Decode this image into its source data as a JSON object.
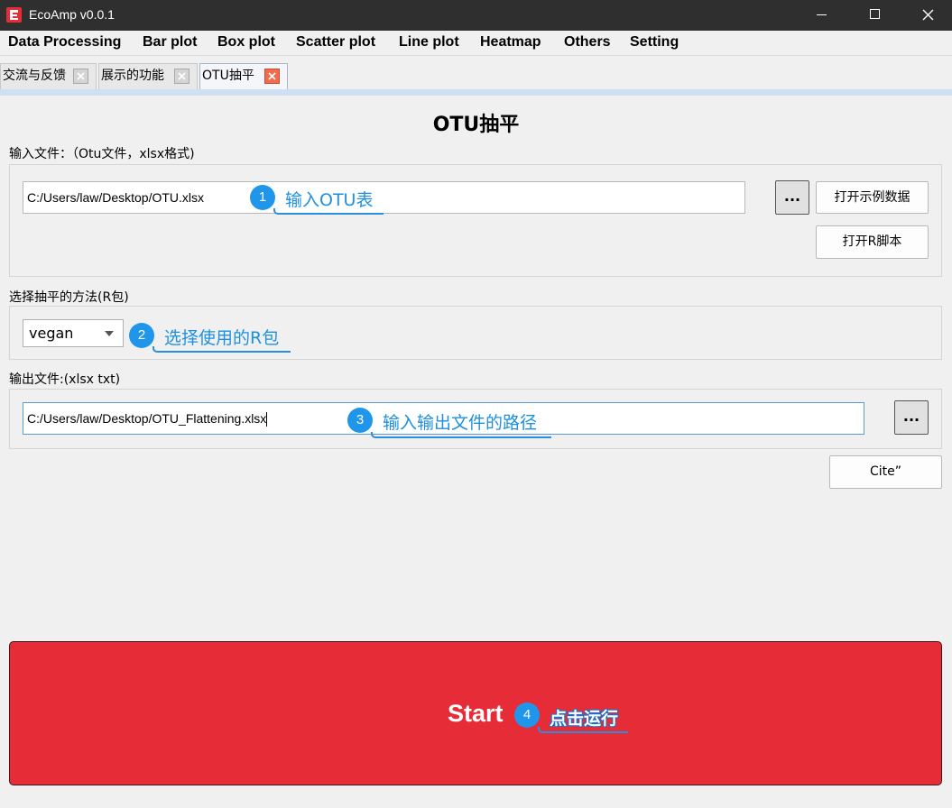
{
  "window": {
    "title": "EcoAmp v0.0.1",
    "icons": {
      "logo": "app-logo-icon",
      "minimize": "minimize-icon",
      "maximize": "maximize-icon",
      "close": "close-icon"
    }
  },
  "menu": [
    "Data Processing",
    "Bar plot",
    "Box plot",
    "Scatter plot",
    "Line plot",
    "Heatmap",
    "Others",
    "Setting"
  ],
  "tabs": [
    {
      "label": "交流与反馈",
      "active": false
    },
    {
      "label": "展示的功能",
      "active": false
    },
    {
      "label": "OTU抽平",
      "active": true
    }
  ],
  "page": {
    "title": "OTU抽平",
    "input_section": {
      "label": "输入文件：（Otu文件，xlsx格式)",
      "path_value": "C:/Users/law/Desktop/OTU.xlsx",
      "browse_label": "...",
      "open_example_label": "打开示例数据",
      "open_script_label": "打开R脚本"
    },
    "method_section": {
      "label": "选择抽平的方法(R包)",
      "selected": "vegan"
    },
    "output_section": {
      "label": "输出文件:(xlsx txt)",
      "path_value": "C:/Users/law/Desktop/OTU_Flattening.xlsx",
      "browse_label": "..."
    },
    "cite_label": "Cite”",
    "start_label": "Start"
  },
  "annotations": [
    {
      "number": "1",
      "text": "输入OTU表"
    },
    {
      "number": "2",
      "text": "选择使用的R包"
    },
    {
      "number": "3",
      "text": "输入输出文件的路径"
    },
    {
      "number": "4",
      "text": "点击运行"
    }
  ],
  "colors": {
    "titlebar": "#2f2f2f",
    "accent_red": "#e62d37",
    "annotation_blue": "#1f96ea",
    "tab_strip": "#cfe0f3"
  }
}
